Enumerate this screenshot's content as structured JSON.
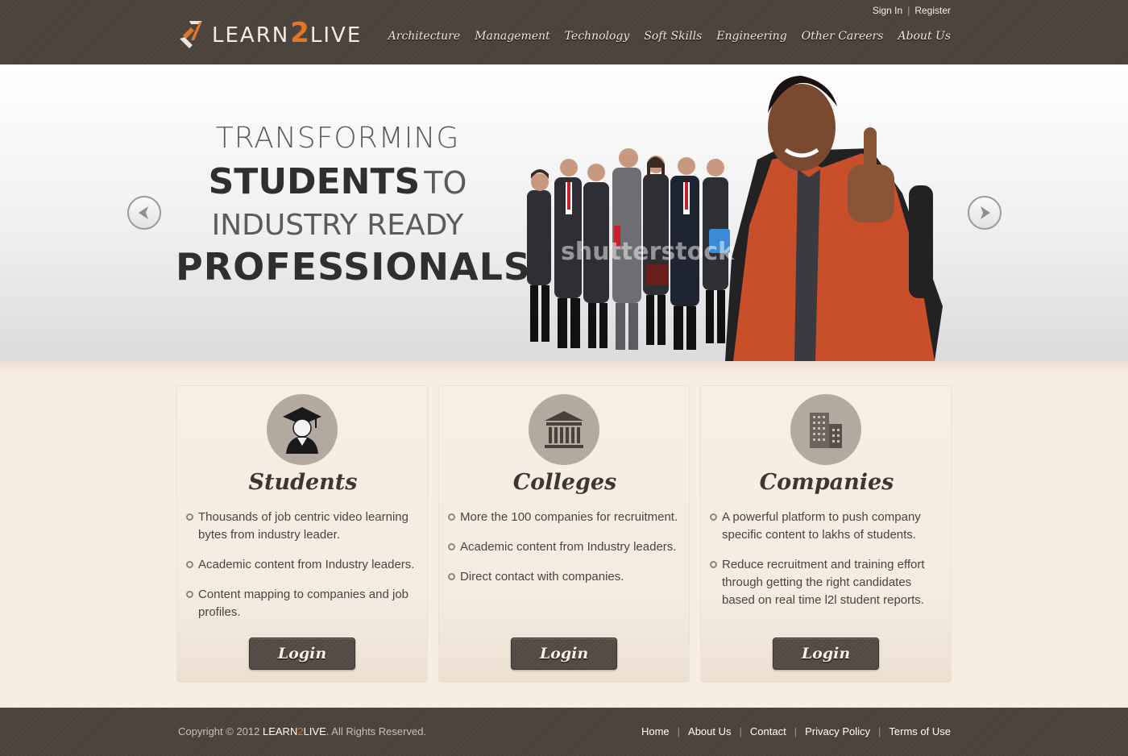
{
  "header": {
    "logo": {
      "prefix": "LEARN",
      "two": "2",
      "suffix": "LIVE"
    },
    "topbar": {
      "sign_in": "Sign In",
      "separator": "|",
      "register": "Register"
    },
    "nav": [
      "Architecture",
      "Management",
      "Technology",
      "Soft Skills",
      "Engineering",
      "Other Careers",
      "About Us"
    ]
  },
  "hero": {
    "line1": "TRANSFORMING",
    "line2_strong": "STUDENTS",
    "line2_thin": "TO",
    "line3": "INDUSTRY READY",
    "line4": "PROFESSIONALS",
    "watermark": "shutterstock"
  },
  "cards": [
    {
      "title": "Students",
      "icon": "graduate-icon",
      "bullets": [
        "Thousands of job centric video learning bytes from industry leader.",
        "Academic content from Industry leaders.",
        "Content mapping to companies and job profiles."
      ],
      "button": "Login"
    },
    {
      "title": "Colleges",
      "icon": "college-building-icon",
      "bullets": [
        "More the 100 companies for recruitment.",
        "Academic content from Industry leaders.",
        "Direct contact with companies."
      ],
      "button": "Login"
    },
    {
      "title": "Companies",
      "icon": "office-buildings-icon",
      "bullets": [
        "A powerful platform to push company specific content to lakhs of students.",
        "Reduce recruitment and training effort through getting the right candidates based on real time l2l student reports."
      ],
      "button": "Login"
    }
  ],
  "footer": {
    "copyright_prefix": "Copyright © 2012 ",
    "brand_prefix": "LEARN",
    "brand_two": "2",
    "brand_suffix": "LIVE",
    "copyright_suffix": ". All Rights Reserved.",
    "links": [
      "Home",
      "About Us",
      "Contact",
      "Privacy Policy",
      "Terms of Use"
    ],
    "separator": "|"
  },
  "colors": {
    "header_bg": "#4f4640",
    "accent": "#e2772a",
    "page_bg": "#f7ede1",
    "icon_circle": "#b3a99e"
  }
}
